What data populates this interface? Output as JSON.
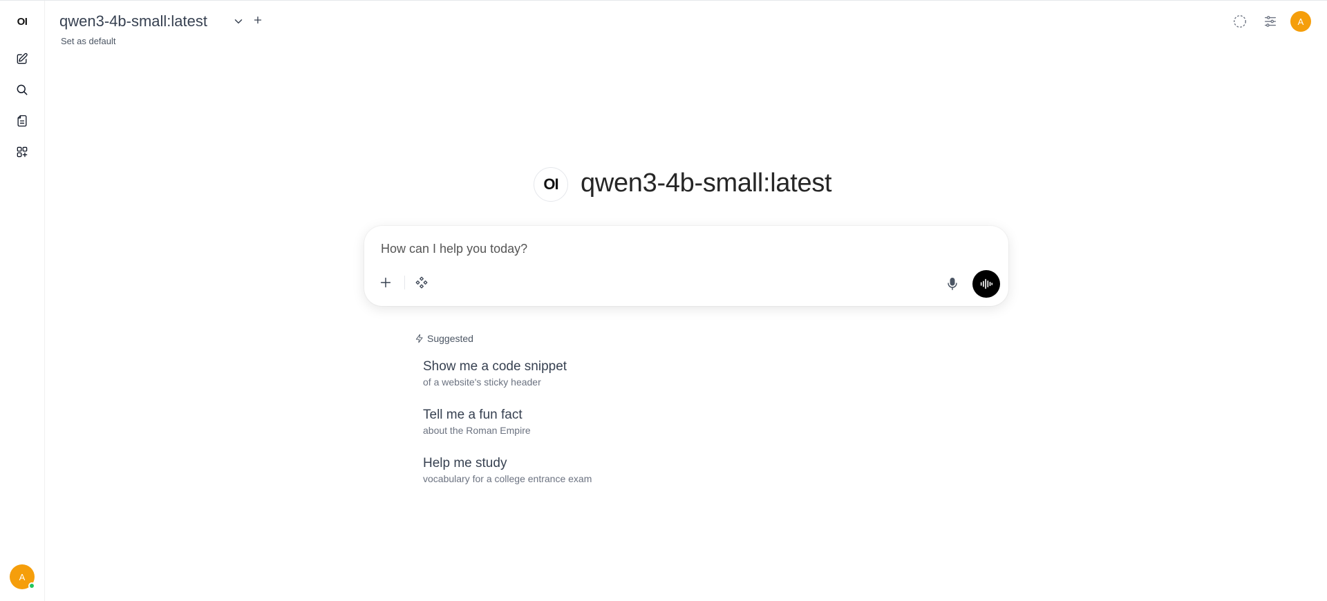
{
  "sidebar": {
    "logo_text": "OI",
    "items": [
      {
        "name": "new-chat",
        "icon": "pencil-square-icon"
      },
      {
        "name": "search",
        "icon": "search-icon"
      },
      {
        "name": "notes",
        "icon": "notes-icon"
      },
      {
        "name": "workspace",
        "icon": "apps-plus-icon"
      }
    ],
    "user_initial": "A"
  },
  "header": {
    "model_name": "qwen3-4b-small:latest",
    "set_default_label": "Set as default",
    "user_initial": "A"
  },
  "hero": {
    "logo_text": "OI",
    "title": "qwen3-4b-small:latest"
  },
  "composer": {
    "placeholder": "How can I help you today?"
  },
  "suggestions": {
    "label": "Suggested",
    "items": [
      {
        "title": "Show me a code snippet",
        "subtitle": "of a website's sticky header"
      },
      {
        "title": "Tell me a fun fact",
        "subtitle": "about the Roman Empire"
      },
      {
        "title": "Help me study",
        "subtitle": "vocabulary for a college entrance exam"
      }
    ]
  },
  "colors": {
    "avatar": "#f59e0b",
    "online": "#22c55e",
    "voice_button": "#000000"
  }
}
